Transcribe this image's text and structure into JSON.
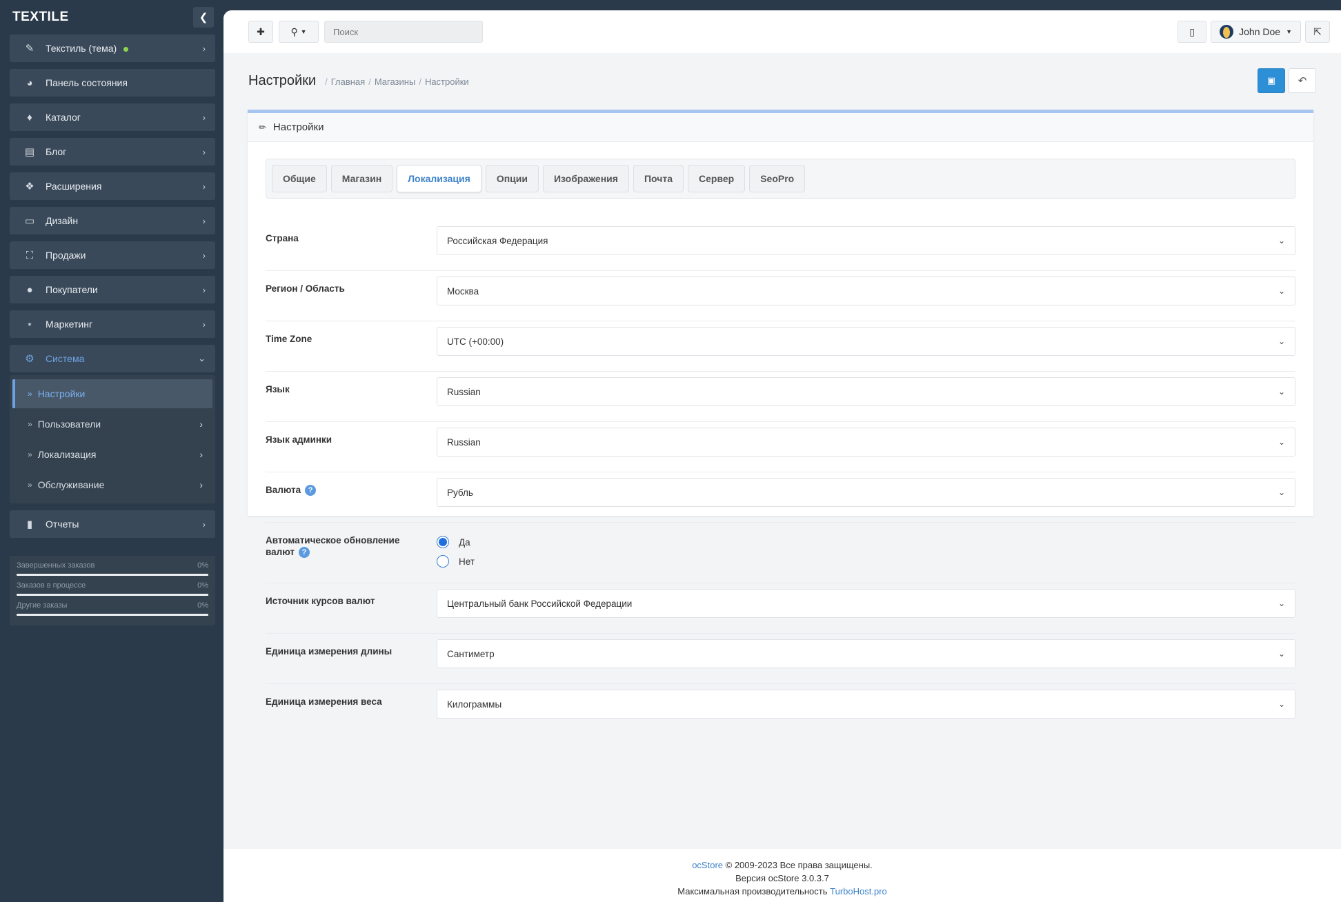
{
  "sidebar": {
    "brand": "TEXTILE",
    "items": [
      {
        "label": "Текстиль (тема)",
        "icon": "edit-icon"
      },
      {
        "label": "Панель состояния",
        "icon": "dashboard-icon"
      },
      {
        "label": "Каталог",
        "icon": "tags-icon"
      },
      {
        "label": "Блог",
        "icon": "book-icon"
      },
      {
        "label": "Расширения",
        "icon": "puzzle-icon"
      },
      {
        "label": "Дизайн",
        "icon": "monitor-icon"
      },
      {
        "label": "Продажи",
        "icon": "cart-icon"
      },
      {
        "label": "Покупатели",
        "icon": "user-icon"
      },
      {
        "label": "Маркетинг",
        "icon": "share-icon"
      },
      {
        "label": "Система",
        "icon": "gear-icon"
      },
      {
        "label": "Отчеты",
        "icon": "bar-chart-icon"
      }
    ],
    "submenu": [
      {
        "label": "Настройки"
      },
      {
        "label": "Пользователи"
      },
      {
        "label": "Локализация"
      },
      {
        "label": "Обслуживание"
      }
    ],
    "stats": [
      {
        "label": "Завершенных заказов",
        "value": "0%"
      },
      {
        "label": "Заказов в процессе",
        "value": "0%"
      },
      {
        "label": "Другие заказы",
        "value": "0%"
      }
    ]
  },
  "topbar": {
    "search_placeholder": "Поиск",
    "user_name": "John Doe"
  },
  "page": {
    "title": "Настройки",
    "breadcrumbs": [
      "Главная",
      "Магазины",
      "Настройки"
    ],
    "card_title": "Настройки"
  },
  "tabs": [
    {
      "label": "Общие"
    },
    {
      "label": "Магазин"
    },
    {
      "label": "Локализация",
      "active": true
    },
    {
      "label": "Опции"
    },
    {
      "label": "Изображения"
    },
    {
      "label": "Почта"
    },
    {
      "label": "Сервер"
    },
    {
      "label": "SeoPro"
    }
  ],
  "form": {
    "country": {
      "label": "Страна",
      "value": "Российская Федерация"
    },
    "region": {
      "label": "Регион / Область",
      "value": "Москва"
    },
    "timezone": {
      "label": "Time Zone",
      "value": "UTC (+00:00)"
    },
    "language": {
      "label": "Язык",
      "value": "Russian"
    },
    "admin_language": {
      "label": "Язык админки",
      "value": "Russian"
    },
    "currency": {
      "label": "Валюта",
      "value": "Рубль"
    },
    "auto_update": {
      "label_line1": "Автоматическое обновление",
      "label_line2": "валют",
      "option_yes": "Да",
      "option_no": "Нет",
      "selected": "yes"
    },
    "rate_source": {
      "label": "Источник курсов валют",
      "value": "Центральный банк Российской Федерации"
    },
    "length_unit": {
      "label": "Единица измерения длины",
      "value": "Сантиметр"
    },
    "weight_unit": {
      "label": "Единица измерения веса",
      "value": "Килограммы"
    }
  },
  "footer": {
    "brand_link": "ocStore",
    "copyright": "© 2009-2023 Все права защищены.",
    "version": "Версия ocStore 3.0.3.7",
    "perf_text": "Максимальная производительность",
    "perf_link": "TurboHost.pro"
  },
  "colors": {
    "sidebar_bg": "#2b3a4a",
    "accent": "#3d82c9",
    "save_button": "#2d8fd5"
  }
}
